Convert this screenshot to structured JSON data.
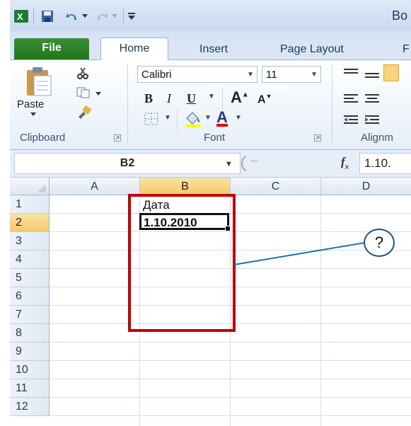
{
  "title_bar": {
    "title": "Bo"
  },
  "tabs": [
    "File",
    "Home",
    "Insert",
    "Page Layout",
    "F"
  ],
  "ribbon": {
    "clipboard": {
      "paste_label": "Paste",
      "group_label": "Clipboard"
    },
    "font": {
      "font_name": "Calibri",
      "font_size": "11",
      "group_label": "Font"
    },
    "alignment": {
      "group_label": "Alignm"
    }
  },
  "formula_bar": {
    "name_box": "B2",
    "fx": "fx",
    "formula_value": "1.10."
  },
  "grid": {
    "columns": [
      "A",
      "B",
      "C",
      "D"
    ],
    "selected_column": "B",
    "rows": [
      "1",
      "2",
      "3",
      "4",
      "5",
      "6",
      "7",
      "8",
      "9",
      "10",
      "11",
      "12"
    ],
    "selected_row": "2",
    "cells": {
      "B1": "Дата",
      "B2": "1.10.2010"
    }
  },
  "callout": {
    "label": "?"
  },
  "colors": {
    "selection_border": "#c00000",
    "callout_line": "#1f6fb2",
    "file_tab": "#2e7d32",
    "header_selected": "#f6c867"
  }
}
